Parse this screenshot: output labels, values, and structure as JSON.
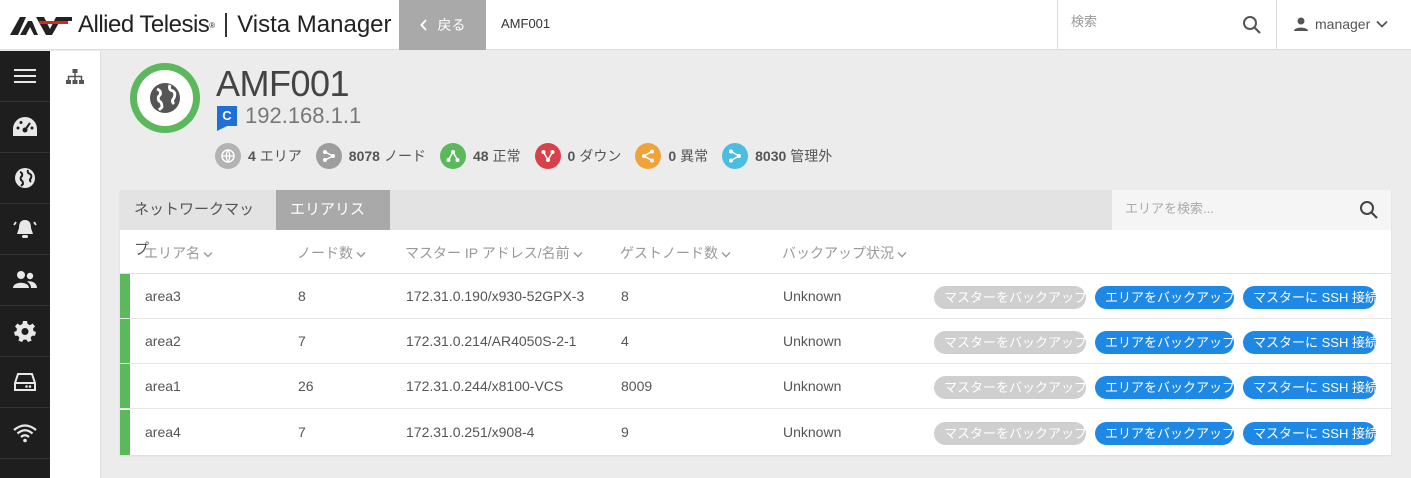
{
  "header": {
    "brand": "Allied Telesis",
    "brand_reg": "®",
    "product": "Vista Manager",
    "back_label": "戻る",
    "breadcrumb": "AMF001",
    "search_placeholder": "検索",
    "user": "manager"
  },
  "device": {
    "name": "AMF001",
    "badge": "C",
    "ip": "192.168.1.1",
    "status_color": "#5cb85c"
  },
  "stats": [
    {
      "count": "4",
      "label": "エリア",
      "icon": "globe-icon",
      "color": "#b3b3b3"
    },
    {
      "count": "8078",
      "label": "ノード",
      "icon": "node-icon",
      "color": "#9e9e9e"
    },
    {
      "count": "48",
      "label": "正常",
      "icon": "up-icon",
      "color": "#5cb85c"
    },
    {
      "count": "0",
      "label": "ダウン",
      "icon": "down-icon",
      "color": "#d9414a"
    },
    {
      "count": "0",
      "label": "異常",
      "icon": "warning-icon",
      "color": "#f0a33a"
    },
    {
      "count": "8030",
      "label": "管理外",
      "icon": "unmanaged-icon",
      "color": "#4bbde0"
    }
  ],
  "tabs": {
    "network_map": "ネットワークマップ",
    "area_list": "エリアリスト"
  },
  "area_search_placeholder": "エリアを検索...",
  "table": {
    "headers": {
      "area": "エリア名",
      "nodes": "ノード数",
      "master": "マスター IP アドレス/名前",
      "guests": "ゲストノード数",
      "backup": "バックアップ状況"
    },
    "rows": [
      {
        "area": "area3",
        "nodes": "8",
        "master": "172.31.0.190/x930-52GPX-3",
        "guests": "8",
        "backup": "Unknown"
      },
      {
        "area": "area2",
        "nodes": "7",
        "master": "172.31.0.214/AR4050S-2-1",
        "guests": "4",
        "backup": "Unknown"
      },
      {
        "area": "area1",
        "nodes": "26",
        "master": "172.31.0.244/x8100-VCS",
        "guests": "8009",
        "backup": "Unknown"
      },
      {
        "area": "area4",
        "nodes": "7",
        "master": "172.31.0.251/x908-4",
        "guests": "9",
        "backup": "Unknown"
      }
    ],
    "actions": {
      "backup_master": "マスターをバックアップ",
      "backup_area": "エリアをバックアップ",
      "ssh_master": "マスターに SSH 接続"
    }
  },
  "colors": {
    "accent_blue": "#1e88e5",
    "ok_green": "#5cb85c",
    "nav_dark": "#1e1e1e"
  }
}
